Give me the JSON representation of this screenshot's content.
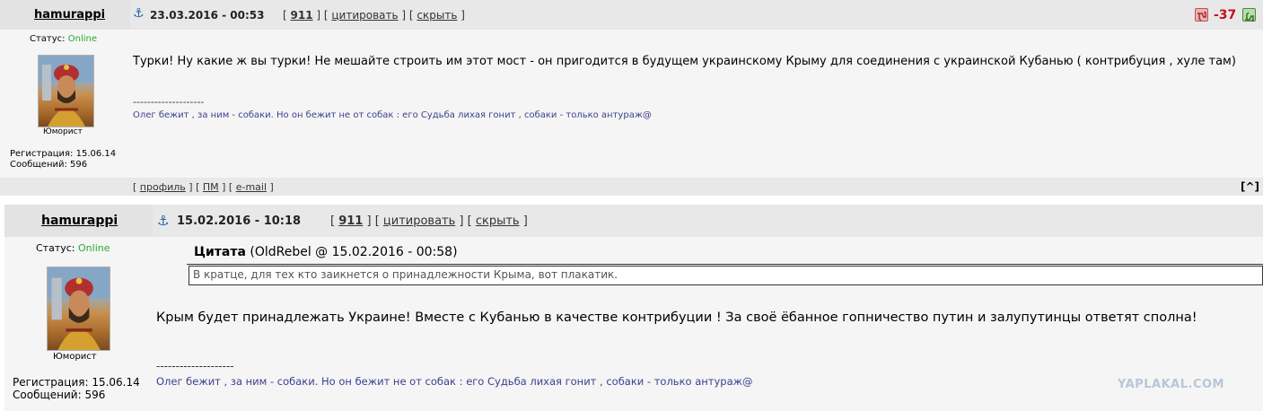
{
  "post1": {
    "author": "hamurappi",
    "date": "23.03.2016 - 00:53",
    "rating_link": "911",
    "action_quote": "цитировать",
    "action_hide": "скрыть",
    "bracket_open": "[",
    "bracket_close": "]",
    "separator": "] [",
    "score": "-37",
    "status_label": "Статус:",
    "status_value": "Online",
    "rank": "Юморист",
    "reg_label": "Регистрация: 15.06.14",
    "posts_label": "Сообщений: 596",
    "message": "Турки! Ну какие ж вы турки! Не мешайте строить им этот мост - он пригодится в будущем украинскому Крыму для соединения с украинской Кубанью ( контрибуция , хуле там)",
    "sig_separator": "--------------------",
    "signature": "Олег бежит , за ним - собаки. Но он бежит не от собак : его Судьба лихая гонит , собаки - только антураж@",
    "footer_profile": "профиль",
    "footer_pm": "ПМ",
    "footer_email": "e-mail",
    "top_link": "[^]"
  },
  "post2": {
    "author": "hamurappi",
    "date": "15.02.2016 - 10:18",
    "rating_link": "911",
    "action_quote": "цитировать",
    "action_hide": "скрыть",
    "status_label": "Статус:",
    "status_value": "Online",
    "rank": "Юморист",
    "reg_label": "Регистрация: 15.06.14",
    "posts_label": "Сообщений: 596",
    "quote_title": "Цитата",
    "quote_meta": "(OldRebel @ 15.02.2016 - 00:58)",
    "quote_text": "В кратце, для тех кто заикнется о принадлежности Крыма, вот плакатик.",
    "message": "Крым будет принадлежать Украине! Вместе с Кубанью в качестве контрибуции ! За своё ёбанное гопничество путин и залупутинцы ответят сполна!",
    "sig_separator": "--------------------",
    "signature": "Олег бежит , за ним - собаки. Но он бежит не от собак : его Судьба лихая гонит , собаки - только антураж@"
  },
  "watermark": "YAPLAKAL.COM",
  "colors": {
    "rating": "#c0101a",
    "online": "#2aa832",
    "signature": "#3c3f8f"
  }
}
